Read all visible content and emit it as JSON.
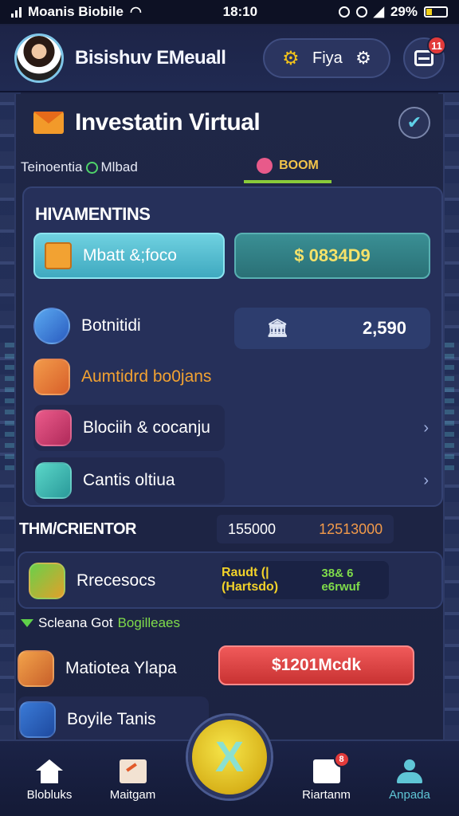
{
  "status_bar": {
    "carrier": "Moanis Biobile",
    "time": "18:10",
    "battery": "29%"
  },
  "header": {
    "player_name": "Bisishuv EMeuall",
    "currency_label": "Fiya",
    "mail_badge": "11"
  },
  "panel": {
    "title": "Investatin Virtual",
    "tabs": [
      {
        "label": "Teinoentia",
        "extra": "Mlbad"
      },
      {
        "label": "BOOM"
      }
    ]
  },
  "investments": {
    "title": "HIVAMENTINS",
    "primary_button": "Mbatt &;foco",
    "primary_value": "$ 0834D9",
    "rows": [
      {
        "label": "Botnitidi",
        "value": "2,590"
      },
      {
        "label": "Aumtidrd bo0jans"
      },
      {
        "label": "Blociih & cocanju"
      },
      {
        "label": "Cantis oltiua"
      }
    ]
  },
  "stats": {
    "title": "THM/CRIENTOR",
    "value_a": "155000",
    "value_b": "12513000"
  },
  "resources": {
    "label": "Rrecesocs",
    "value_main": "Raudt (|(Hartsdo)",
    "value_sub": "38& 6 e6rwuf"
  },
  "note": {
    "prefix": "Scleana Got",
    "highlight": "Bogilleaes"
  },
  "bottom_rows": [
    {
      "label": "Matiotea Ylapa",
      "button": "$1201Mcdk"
    },
    {
      "label": "Boyile Tanis"
    }
  ],
  "bottom_nav": {
    "items": [
      {
        "label": "Blobluks"
      },
      {
        "label": "Maitgam"
      },
      {
        "label": "Riartanm",
        "badge": "8"
      },
      {
        "label": "Anpada"
      }
    ],
    "center_symbol": "X"
  }
}
